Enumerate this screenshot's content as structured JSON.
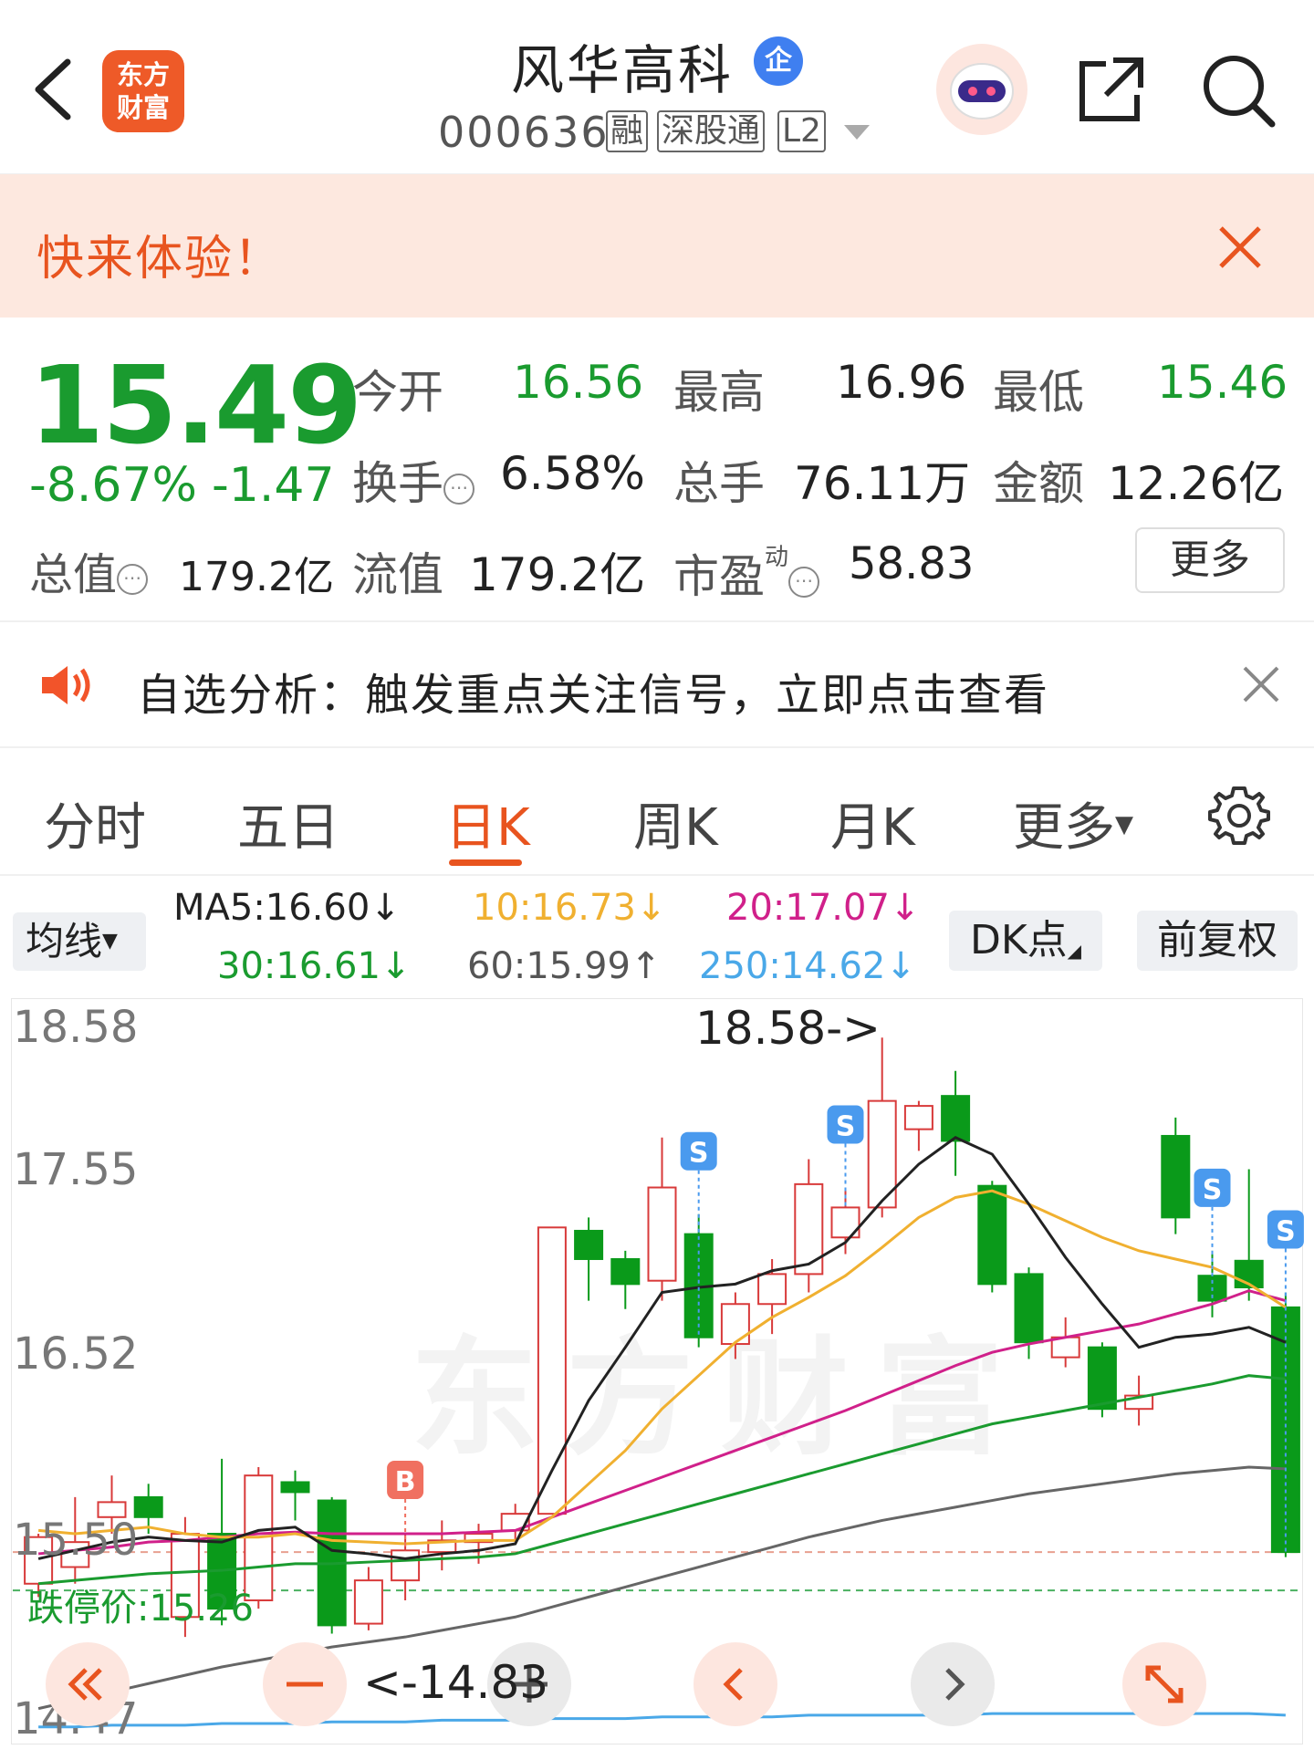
{
  "header": {
    "title": "风华高科",
    "badge": "企",
    "code": "000636",
    "tags": [
      "融",
      "深股通",
      "L2"
    ],
    "logo_top": "东方",
    "logo_bottom": "财富"
  },
  "promo": {
    "text": "快来体验！"
  },
  "quote": {
    "price": "15.49",
    "change_pct": "-8.67%",
    "change_abs": "-1.47",
    "open_label": "今开",
    "open": "16.56",
    "high_label": "最高",
    "high": "16.96",
    "low_label": "最低",
    "low": "15.46",
    "turnover_label": "换手",
    "turnover": "6.58%",
    "volume_label": "总手",
    "volume": "76.11万",
    "amount_label": "金额",
    "amount": "12.26亿",
    "mktcap_label": "总值",
    "mktcap": "179.2亿",
    "float_label": "流值",
    "float": "179.2亿",
    "pe_label": "市盈",
    "pe_sup": "动",
    "pe": "58.83",
    "more": "更多"
  },
  "notice": {
    "text": "自选分析：触发重点关注信号，立即点击查看"
  },
  "tabs": [
    "分时",
    "五日",
    "日K",
    "周K",
    "月K",
    "更多"
  ],
  "active_tab": "日K",
  "ma_bar": {
    "selector": "均线",
    "ma5": "MA5:16.60↓",
    "ma10": "10:16.73↓",
    "ma20": "20:17.07↓",
    "ma30": "30:16.61↓",
    "ma60": "60:15.99↑",
    "ma250": "250:14.62↓",
    "dk": "DK点",
    "adjust": "前复权",
    "colors": {
      "ma5": "#222222",
      "ma10": "#f0b030",
      "ma20": "#d0208a",
      "ma30": "#1a9b2f",
      "ma60": "#666666",
      "ma250": "#4aa8e8"
    }
  },
  "chart_data": {
    "type": "candlestick",
    "y_axis_labels": [
      "18.58",
      "17.55",
      "16.52",
      "15.50",
      "14.47"
    ],
    "high_marker": "18.58->",
    "low_marker": "<-14.83",
    "limit_down_label": "跌停价:15.26",
    "up_color": "#d83a3a",
    "down_color": "#0a9a1a",
    "candles": [
      {
        "o": 15.3,
        "c": 15.58,
        "h": 15.6,
        "l": 15.22
      },
      {
        "o": 15.4,
        "c": 15.55,
        "h": 15.82,
        "l": 15.3
      },
      {
        "o": 15.7,
        "c": 15.79,
        "h": 15.95,
        "l": 15.6
      },
      {
        "o": 15.82,
        "c": 15.7,
        "h": 15.9,
        "l": 15.6
      },
      {
        "o": 15.1,
        "c": 15.6,
        "h": 15.7,
        "l": 14.98
      },
      {
        "o": 15.6,
        "c": 15.15,
        "h": 16.05,
        "l": 15.05
      },
      {
        "o": 15.2,
        "c": 15.95,
        "h": 16.0,
        "l": 15.15
      },
      {
        "o": 15.91,
        "c": 15.85,
        "h": 15.98,
        "l": 15.68
      },
      {
        "o": 15.8,
        "c": 15.05,
        "h": 15.82,
        "l": 15.0
      },
      {
        "o": 15.06,
        "c": 15.32,
        "h": 15.4,
        "l": 15.02
      },
      {
        "o": 15.32,
        "c": 15.5,
        "h": 15.6,
        "l": 15.2
      },
      {
        "o": 15.49,
        "c": 15.56,
        "h": 15.68,
        "l": 15.38
      },
      {
        "o": 15.55,
        "c": 15.6,
        "h": 15.66,
        "l": 15.42
      },
      {
        "o": 15.62,
        "c": 15.72,
        "h": 15.78,
        "l": 15.55
      },
      {
        "o": 15.72,
        "c": 17.44,
        "h": 17.44,
        "l": 15.72
      },
      {
        "o": 17.42,
        "c": 17.25,
        "h": 17.5,
        "l": 17.0
      },
      {
        "o": 17.25,
        "c": 17.1,
        "h": 17.3,
        "l": 16.95
      },
      {
        "o": 17.12,
        "c": 17.68,
        "h": 17.98,
        "l": 17.0
      },
      {
        "o": 17.4,
        "c": 16.78,
        "h": 17.52,
        "l": 16.72
      },
      {
        "o": 16.74,
        "c": 16.98,
        "h": 17.05,
        "l": 16.65
      },
      {
        "o": 16.98,
        "c": 17.16,
        "h": 17.25,
        "l": 16.8
      },
      {
        "o": 17.16,
        "c": 17.7,
        "h": 17.85,
        "l": 17.05
      },
      {
        "o": 17.38,
        "c": 17.56,
        "h": 17.68,
        "l": 17.28
      },
      {
        "o": 17.56,
        "c": 18.2,
        "h": 18.58,
        "l": 17.5
      },
      {
        "o": 18.03,
        "c": 18.17,
        "h": 18.2,
        "l": 17.9
      },
      {
        "o": 18.23,
        "c": 17.96,
        "h": 18.38,
        "l": 17.75
      },
      {
        "o": 17.69,
        "c": 17.1,
        "h": 17.72,
        "l": 17.05
      },
      {
        "o": 17.16,
        "c": 16.75,
        "h": 17.2,
        "l": 16.65
      },
      {
        "o": 16.66,
        "c": 16.78,
        "h": 16.9,
        "l": 16.6
      },
      {
        "o": 16.72,
        "c": 16.35,
        "h": 16.75,
        "l": 16.3
      },
      {
        "o": 16.35,
        "c": 16.43,
        "h": 16.55,
        "l": 16.25
      },
      {
        "o": 17.99,
        "c": 17.5,
        "h": 18.1,
        "l": 17.4
      },
      {
        "o": 17.15,
        "c": 17.0,
        "h": 17.3,
        "l": 16.9
      },
      {
        "o": 17.24,
        "c": 17.08,
        "h": 17.79,
        "l": 17.0
      },
      {
        "o": 16.96,
        "c": 15.49,
        "h": 17.05,
        "l": 15.46
      }
    ],
    "ma5": [
      15.45,
      15.5,
      15.55,
      15.58,
      15.56,
      15.55,
      15.62,
      15.64,
      15.5,
      15.48,
      15.45,
      15.48,
      15.5,
      15.54,
      15.98,
      16.4,
      16.72,
      17.05,
      17.08,
      17.1,
      17.18,
      17.22,
      17.35,
      17.6,
      17.82,
      17.98,
      17.88,
      17.58,
      17.26,
      16.98,
      16.72,
      16.78,
      16.8,
      16.84,
      16.75
    ],
    "ma10": [
      15.62,
      15.6,
      15.62,
      15.64,
      15.6,
      15.58,
      15.58,
      15.6,
      15.56,
      15.55,
      15.54,
      15.55,
      15.56,
      15.56,
      15.7,
      15.9,
      16.1,
      16.35,
      16.55,
      16.75,
      16.9,
      17.02,
      17.15,
      17.32,
      17.5,
      17.62,
      17.66,
      17.58,
      17.48,
      17.38,
      17.3,
      17.25,
      17.2,
      17.1,
      16.96
    ],
    "ma20": [
      15.48,
      15.5,
      15.52,
      15.55,
      15.56,
      15.58,
      15.6,
      15.61,
      15.6,
      15.6,
      15.6,
      15.6,
      15.61,
      15.62,
      15.7,
      15.78,
      15.86,
      15.94,
      16.02,
      16.1,
      16.18,
      16.26,
      16.34,
      16.43,
      16.52,
      16.61,
      16.69,
      16.74,
      16.78,
      16.82,
      16.86,
      16.92,
      16.98,
      17.06,
      17.0
    ],
    "ma30": [
      15.3,
      15.32,
      15.34,
      15.36,
      15.37,
      15.38,
      15.4,
      15.42,
      15.42,
      15.43,
      15.44,
      15.45,
      15.46,
      15.48,
      15.54,
      15.6,
      15.66,
      15.72,
      15.78,
      15.84,
      15.9,
      15.96,
      16.02,
      16.08,
      16.14,
      16.2,
      16.26,
      16.3,
      16.34,
      16.38,
      16.42,
      16.46,
      16.5,
      16.55,
      16.53
    ],
    "ma60": [
      14.55,
      14.6,
      14.65,
      14.7,
      14.75,
      14.8,
      14.84,
      14.88,
      14.92,
      14.95,
      14.98,
      15.02,
      15.06,
      15.1,
      15.16,
      15.22,
      15.28,
      15.34,
      15.4,
      15.46,
      15.52,
      15.58,
      15.63,
      15.68,
      15.72,
      15.76,
      15.8,
      15.84,
      15.87,
      15.9,
      15.93,
      15.96,
      15.98,
      16.0,
      15.99
    ],
    "ma250": [
      14.44,
      14.44,
      14.45,
      14.45,
      14.45,
      14.46,
      14.46,
      14.46,
      14.47,
      14.47,
      14.47,
      14.48,
      14.48,
      14.48,
      14.49,
      14.49,
      14.49,
      14.5,
      14.5,
      14.5,
      14.5,
      14.51,
      14.51,
      14.51,
      14.51,
      14.51,
      14.52,
      14.52,
      14.52,
      14.52,
      14.52,
      14.52,
      14.52,
      14.52,
      14.51
    ],
    "signals": [
      {
        "type": "B",
        "index": 10
      },
      {
        "type": "S",
        "index": 18
      },
      {
        "type": "S",
        "index": 22
      },
      {
        "type": "S",
        "index": 32
      },
      {
        "type": "S",
        "index": 34
      }
    ],
    "ylim": [
      14.4,
      18.62
    ]
  },
  "controls": [
    "left-double-icon",
    "zoom-out-icon",
    "zoom-in-icon",
    "prev-icon",
    "next-icon",
    "fullscreen-icon"
  ]
}
